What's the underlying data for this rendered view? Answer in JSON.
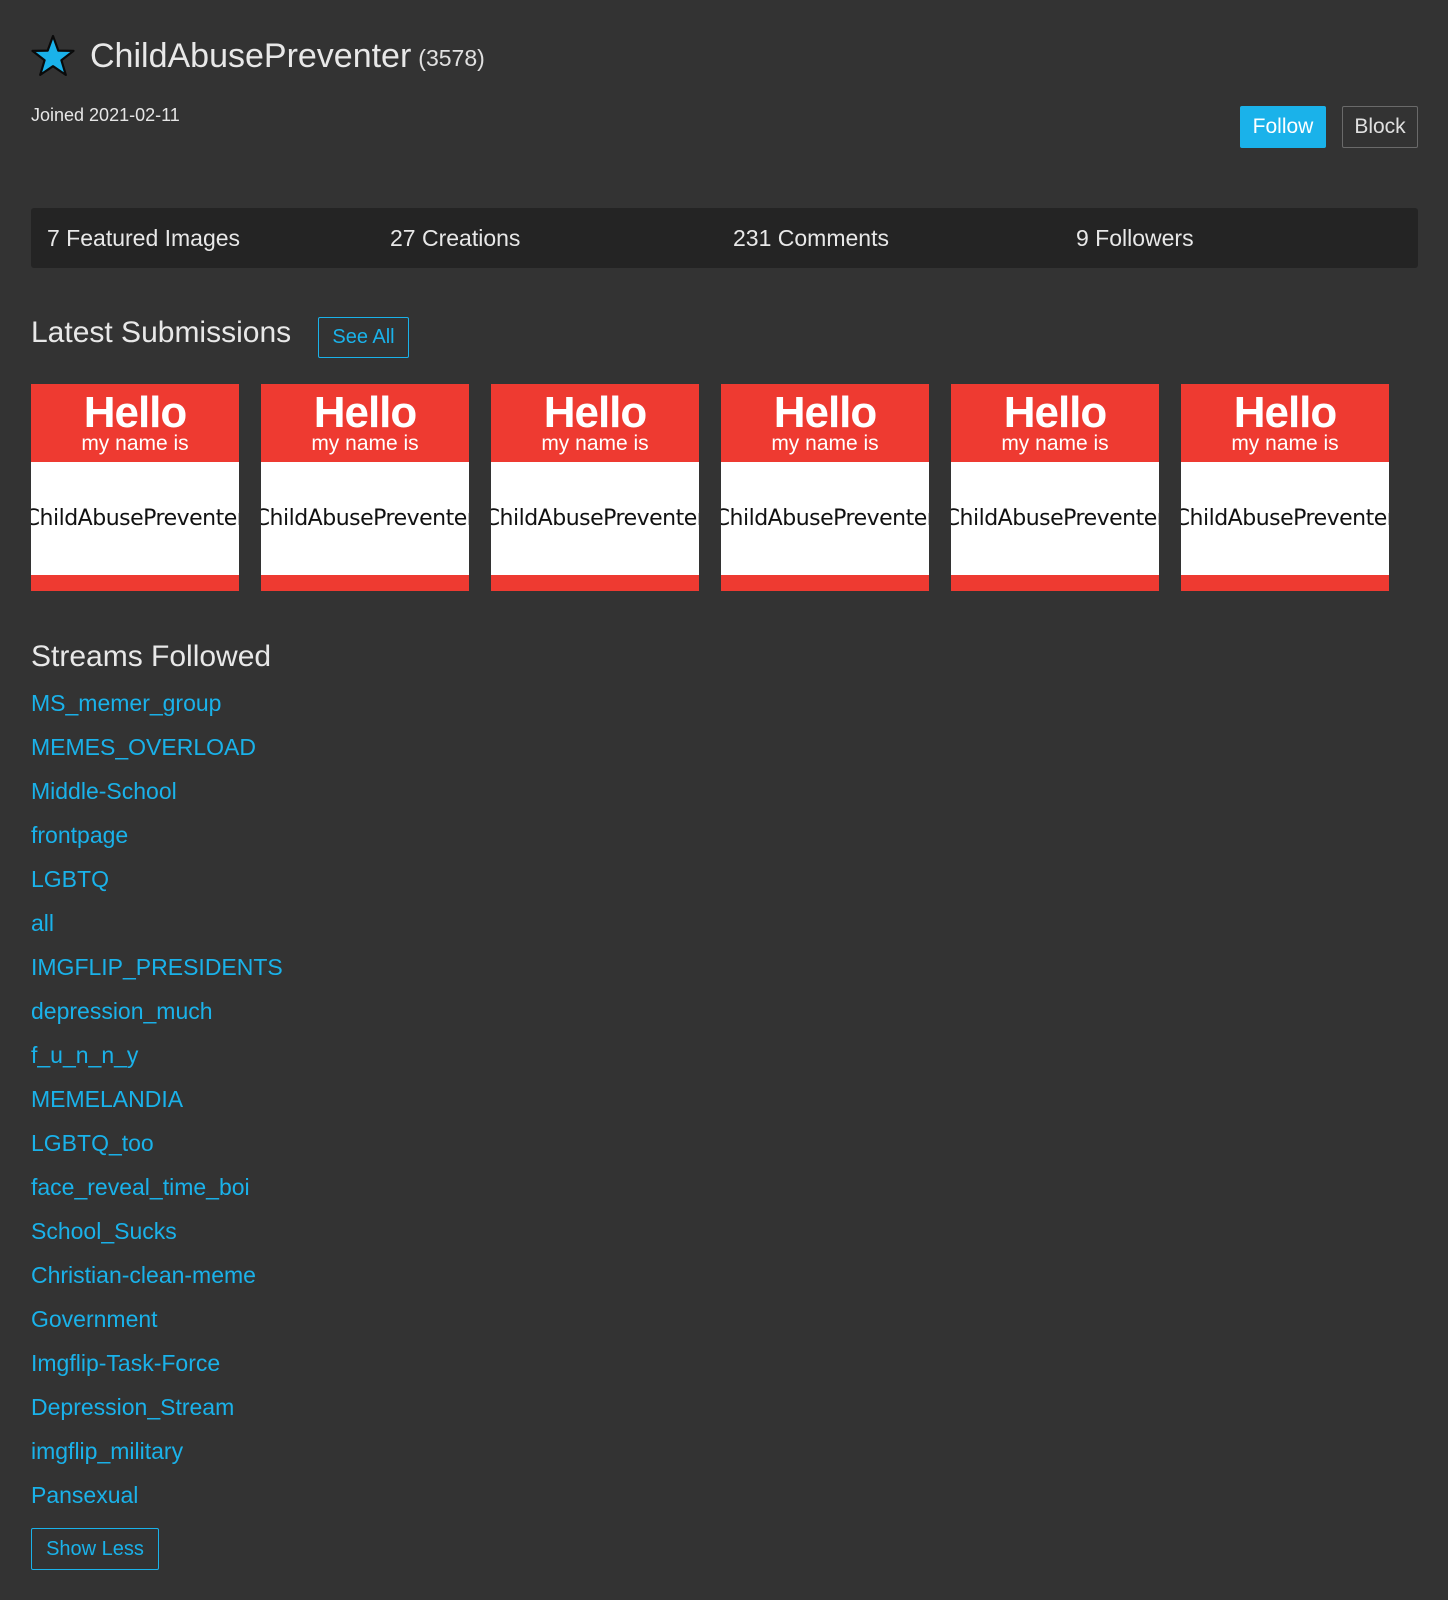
{
  "profile": {
    "username": "ChildAbusePreventer",
    "rank": "(3578)",
    "joined": "Joined 2021-02-11",
    "star_color": "#1ab2ea"
  },
  "actions": {
    "follow_label": "Follow",
    "block_label": "Block"
  },
  "stats": [
    {
      "label": "7 Featured Images"
    },
    {
      "label": "27 Creations"
    },
    {
      "label": "231 Comments"
    },
    {
      "label": "9 Followers"
    }
  ],
  "submissions": {
    "title": "Latest Submissions",
    "see_all_label": "See All",
    "items": [
      {
        "hello": "Hello",
        "subtitle": "my name is",
        "name": "ChildAbusePreventer"
      },
      {
        "hello": "Hello",
        "subtitle": "my name is",
        "name": "ChildAbusePreventer"
      },
      {
        "hello": "Hello",
        "subtitle": "my name is",
        "name": "ChildAbusePreventer"
      },
      {
        "hello": "Hello",
        "subtitle": "my name is",
        "name": "ChildAbusePreventer"
      },
      {
        "hello": "Hello",
        "subtitle": "my name is",
        "name": "ChildAbusePreventer"
      },
      {
        "hello": "Hello",
        "subtitle": "my name is",
        "name": "ChildAbusePreventer"
      }
    ]
  },
  "streams": {
    "title": "Streams Followed",
    "items": [
      "MS_memer_group",
      "MEMES_OVERLOAD",
      "Middle-School",
      "frontpage",
      "LGBTQ",
      "all",
      "IMGFLIP_PRESIDENTS",
      "depression_much",
      "f_u_n_n_y",
      "MEMELANDIA",
      "LGBTQ_too",
      "face_reveal_time_boi",
      "School_Sucks",
      "Christian-clean-meme",
      "Government",
      "Imgflip-Task-Force",
      "Depression_Stream",
      "imgflip_military",
      "Pansexual"
    ],
    "show_less_label": "Show Less"
  },
  "colors": {
    "background": "#333333",
    "accent": "#1ab2ea",
    "stats_bar": "#242424",
    "tag_red": "#ee3a31"
  }
}
